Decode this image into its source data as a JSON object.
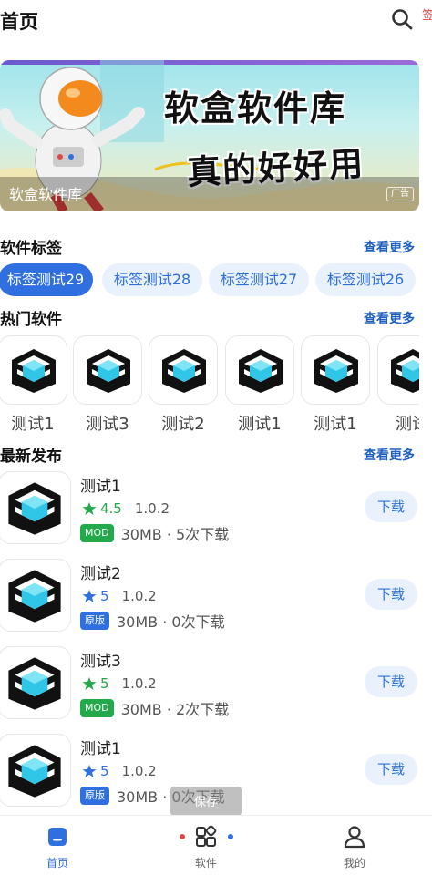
{
  "header": {
    "title": "首页",
    "edge_char": "签"
  },
  "banner": {
    "headline_1": "软盒软件库",
    "headline_2": "真的好好用",
    "caption": "软盒软件库",
    "ad_label": "广告"
  },
  "tags_section": {
    "title": "软件标签",
    "more": "查看更多",
    "tags": [
      "标签测试29",
      "标签测试28",
      "标签测试27",
      "标签测试26"
    ]
  },
  "hot_section": {
    "title": "热门软件",
    "more": "查看更多",
    "apps": [
      "测试1",
      "测试3",
      "测试2",
      "测试1",
      "测试1",
      "测试"
    ]
  },
  "latest_section": {
    "title": "最新发布",
    "more": "查看更多",
    "apps": [
      {
        "name": "测试1",
        "rating": "4.5",
        "version": "1.0.2",
        "badge": "MOD",
        "badge_color": "#22a94a",
        "stats": "30MB · 5次下载",
        "action": "下载"
      },
      {
        "name": "测试2",
        "rating": "5",
        "version": "1.0.2",
        "badge": "原版",
        "badge_color": "#2f6fe0",
        "stats": "30MB · 0次下载",
        "action": "下载"
      },
      {
        "name": "测试3",
        "rating": "5",
        "version": "1.0.2",
        "badge": "MOD",
        "badge_color": "#22a94a",
        "stats": "30MB · 2次下载",
        "action": "下载"
      },
      {
        "name": "测试1",
        "rating": "5",
        "version": "1.0.2",
        "badge": "原版",
        "badge_color": "#2f6fe0",
        "stats": "30MB · 0次下载",
        "action": "下载"
      }
    ]
  },
  "toast": {
    "text": "保存"
  },
  "tabbar": {
    "tabs": [
      {
        "label": "首页",
        "icon": "home-icon",
        "active": true
      },
      {
        "label": "软件",
        "icon": "apps-grid-icon",
        "active": false
      },
      {
        "label": "我的",
        "icon": "user-icon",
        "active": false
      }
    ]
  },
  "colors": {
    "accent": "#2f6fe0",
    "link": "#1f5fbf",
    "star_green": "#22a94a",
    "star_blue": "#2f6fe0",
    "chip_bg": "#e8f1fc"
  }
}
